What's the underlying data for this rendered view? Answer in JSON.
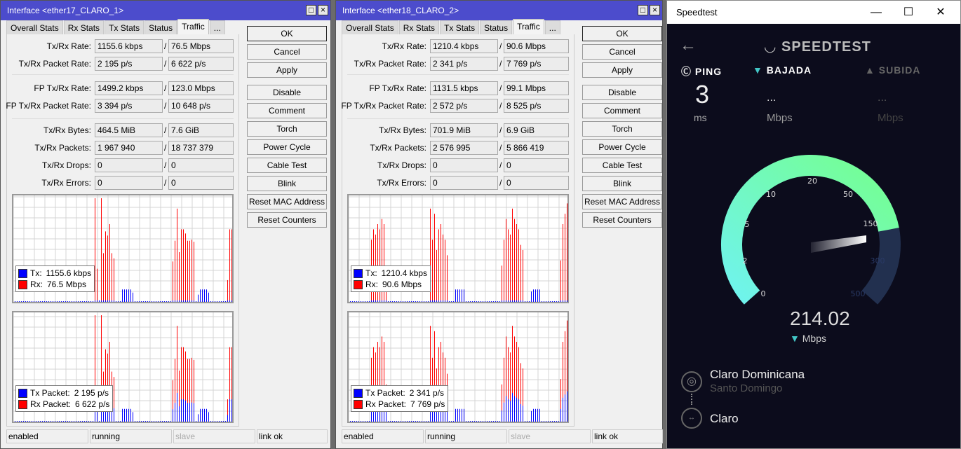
{
  "windows": [
    {
      "title": "Interface <ether17_CLARO_1>",
      "tabs": [
        "Overall Stats",
        "Rx Stats",
        "Tx Stats",
        "Status",
        "Traffic",
        "..."
      ],
      "active_tab": "Traffic",
      "rows": [
        {
          "label": "Tx/Rx Rate:",
          "tx": "1155.6 kbps",
          "rx": "76.5 Mbps"
        },
        {
          "label": "Tx/Rx Packet Rate:",
          "tx": "2 195 p/s",
          "rx": "6 622 p/s"
        },
        {
          "label": "FP Tx/Rx Rate:",
          "tx": "1499.2 kbps",
          "rx": "123.0 Mbps"
        },
        {
          "label": "FP Tx/Rx Packet Rate:",
          "tx": "3 394 p/s",
          "rx": "10 648 p/s"
        },
        {
          "label": "Tx/Rx Bytes:",
          "tx": "464.5 MiB",
          "rx": "7.6 GiB"
        },
        {
          "label": "Tx/Rx Packets:",
          "tx": "1 967 940",
          "rx": "18 737 379"
        },
        {
          "label": "Tx/Rx Drops:",
          "tx": "0",
          "rx": "0"
        },
        {
          "label": "Tx/Rx Errors:",
          "tx": "0",
          "rx": "0"
        }
      ],
      "buttons": [
        "OK",
        "Cancel",
        "Apply",
        "Disable",
        "Comment",
        "Torch",
        "Power Cycle",
        "Cable Test",
        "Blink",
        "Reset MAC Address",
        "Reset Counters"
      ],
      "legend_rate": {
        "tx_label": "Tx:",
        "tx": "1155.6 kbps",
        "rx_label": "Rx:",
        "rx": "76.5 Mbps"
      },
      "legend_packet": {
        "tx_label": "Tx Packet:",
        "tx": "2 195 p/s",
        "rx_label": "Rx Packet:",
        "rx": "6 622 p/s"
      },
      "status": [
        "enabled",
        "running",
        "slave",
        "link ok"
      ],
      "traffic": {
        "rx_bursts": [
          {
            "start": 38,
            "values": [
              1.0,
              0.32,
              0,
              1.0,
              0.47,
              0.68,
              0.64,
              0.75,
              0.47,
              0.42
            ]
          },
          {
            "start": 75,
            "values": [
              0.39,
              0.59,
              0.9,
              0.48,
              0.7,
              0.7,
              0.66,
              0.59,
              0.59,
              0.6,
              0.58
            ]
          },
          {
            "start": 101,
            "values": [
              0.21,
              0.7,
              0.7,
              0.66,
              0.42
            ]
          }
        ],
        "tx_bursts": [
          {
            "start": 51,
            "values": [
              0.12,
              0.12,
              0.12,
              0.12,
              0.12,
              0.09
            ]
          },
          {
            "start": 87,
            "values": [
              0.07,
              0.12,
              0.12,
              0.12,
              0.12,
              0.09
            ]
          }
        ]
      }
    },
    {
      "title": "Interface <ether18_CLARO_2>",
      "tabs": [
        "Overall Stats",
        "Rx Stats",
        "Tx Stats",
        "Status",
        "Traffic",
        "..."
      ],
      "active_tab": "Traffic",
      "rows": [
        {
          "label": "Tx/Rx Rate:",
          "tx": "1210.4 kbps",
          "rx": "90.6 Mbps"
        },
        {
          "label": "Tx/Rx Packet Rate:",
          "tx": "2 341 p/s",
          "rx": "7 769 p/s"
        },
        {
          "label": "FP Tx/Rx Rate:",
          "tx": "1131.5 kbps",
          "rx": "99.1 Mbps"
        },
        {
          "label": "FP Tx/Rx Packet Rate:",
          "tx": "2 572 p/s",
          "rx": "8 525 p/s"
        },
        {
          "label": "Tx/Rx Bytes:",
          "tx": "701.9 MiB",
          "rx": "6.9 GiB"
        },
        {
          "label": "Tx/Rx Packets:",
          "tx": "2 576 995",
          "rx": "5 866 419"
        },
        {
          "label": "Tx/Rx Drops:",
          "tx": "0",
          "rx": "0"
        },
        {
          "label": "Tx/Rx Errors:",
          "tx": "0",
          "rx": "0"
        }
      ],
      "buttons": [
        "OK",
        "Cancel",
        "Apply",
        "Disable",
        "Comment",
        "Torch",
        "Power Cycle",
        "Cable Test",
        "Blink",
        "Reset MAC Address",
        "Reset Counters"
      ],
      "legend_rate": {
        "tx_label": "Tx:",
        "tx": "1210.4 kbps",
        "rx_label": "Rx:",
        "rx": "90.6 Mbps"
      },
      "legend_packet": {
        "tx_label": "Tx Packet:",
        "tx": "2 341 p/s",
        "rx_label": "Rx Packet:",
        "rx": "7 769 p/s"
      },
      "status": [
        "enabled",
        "running",
        "slave",
        "link ok"
      ],
      "traffic": {
        "rx_bursts": [
          {
            "start": 10,
            "values": [
              0.6,
              0.7,
              0.65,
              0.75,
              0.7,
              0.8,
              0.75,
              0.35
            ]
          },
          {
            "start": 38,
            "values": [
              0.9,
              0.6,
              0.85,
              0.5,
              0.7,
              0.75,
              0.65,
              0.6,
              0.45
            ]
          },
          {
            "start": 72,
            "values": [
              0.35,
              0.6,
              0.8,
              0.7,
              0.65,
              0.9,
              0.8,
              0.75,
              0.7,
              0.55,
              0.5
            ]
          },
          {
            "start": 100,
            "values": [
              0.4,
              0.75,
              0.85,
              0.95,
              0.6,
              0.35
            ]
          }
        ],
        "tx_bursts": [
          {
            "start": 50,
            "values": [
              0.12,
              0.12,
              0.12,
              0.12,
              0.12
            ]
          },
          {
            "start": 86,
            "values": [
              0.1,
              0.12,
              0.12,
              0.12,
              0.12
            ]
          }
        ]
      }
    }
  ],
  "speedtest": {
    "window_title": "Speedtest",
    "logo": "SPEEDTEST",
    "ping": {
      "label": "PING",
      "value": "3",
      "unit": "ms"
    },
    "download": {
      "label": "BAJADA",
      "value": "...",
      "unit": "Mbps"
    },
    "upload": {
      "label": "SUBIDA",
      "value": "...",
      "unit": "Mbps"
    },
    "gauge": {
      "ticks": [
        "0",
        "2",
        "5",
        "10",
        "20",
        "50",
        "150",
        "300",
        "500"
      ],
      "current_value": "214.02",
      "unit": "Mbps",
      "fill_fraction": 0.8
    },
    "isp": {
      "name": "Claro Dominicana",
      "location": "Santo Domingo"
    },
    "server": "Claro",
    "colors": {
      "background": "#0c0c1c",
      "gauge_start": "#6ff3ee",
      "gauge_end": "#75ff8f",
      "gauge_track": "#22304f",
      "accent": "#42c6c6"
    }
  }
}
